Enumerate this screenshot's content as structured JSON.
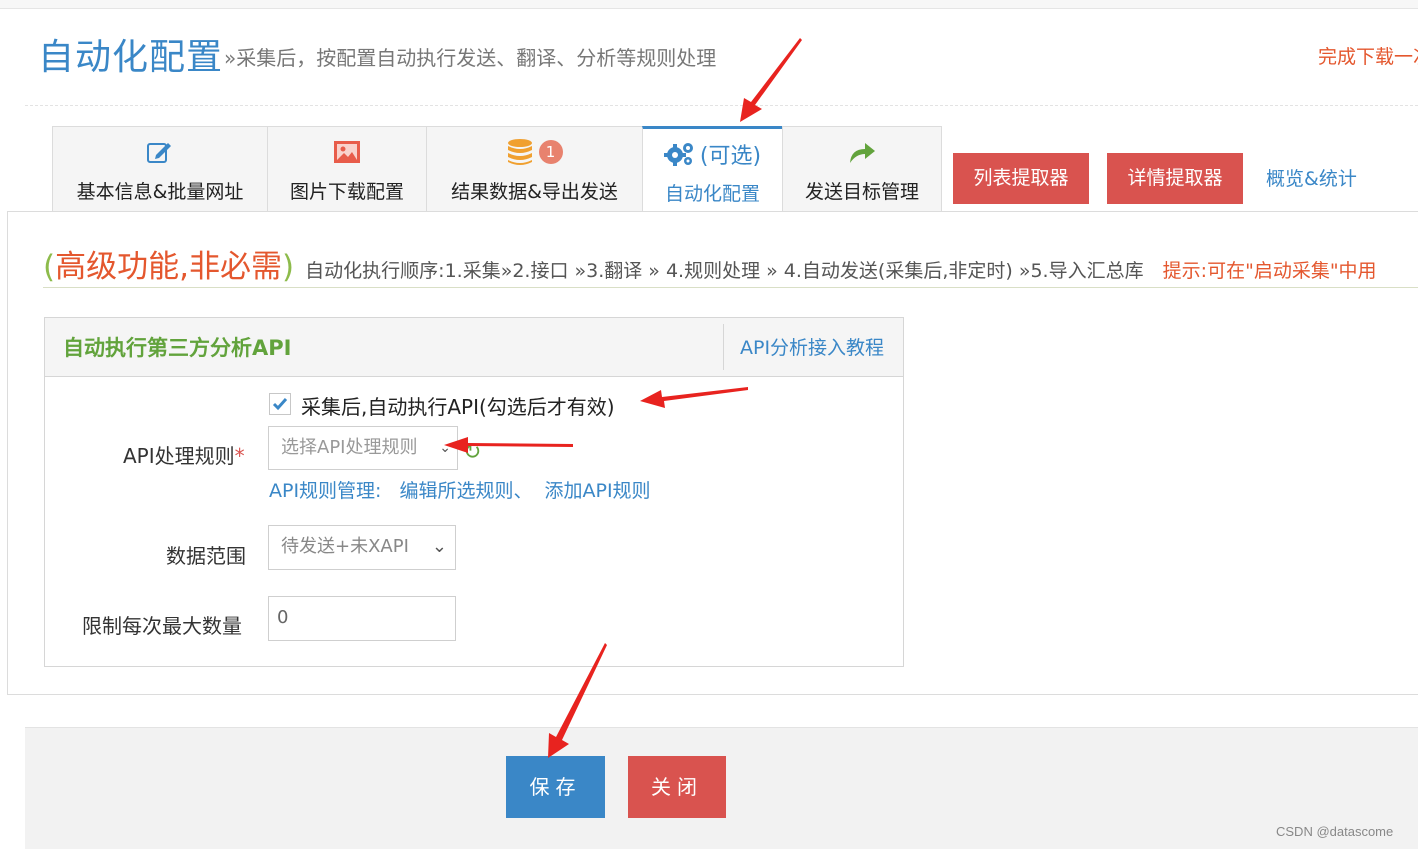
{
  "header": {
    "title": "自动化配置",
    "subtitle": "»采集后，按配置自动执行发送、翻译、分析等规则处理",
    "right_link": "完成下载一次"
  },
  "tabs": [
    {
      "label": "基本信息&批量网址",
      "icon": "edit-icon"
    },
    {
      "label": "图片下载配置",
      "icon": "image-icon"
    },
    {
      "label": "结果数据&导出发送",
      "icon": "database-icon",
      "badge": "1"
    },
    {
      "label": "自动化配置",
      "icon": "gears-icon",
      "sub": "(可选)",
      "active": true
    },
    {
      "label": "发送目标管理",
      "icon": "share-arrow-icon"
    }
  ],
  "actions": {
    "list_extractor": "列表提取器",
    "detail_extractor": "详情提取器",
    "overview": "概览&统计"
  },
  "advanced": {
    "title_open": "(",
    "title": "高级功能,非必需",
    "title_close": ")",
    "order": "自动化执行顺序:1.采集»2.接口 »3.翻译 » 4.规则处理 » 4.自动发送(采集后,非定时) »5.导入汇总库",
    "tip": "提示:可在\"启动采集\"中用"
  },
  "panel": {
    "title": "自动执行第三方分析API",
    "tutorial_link": "API分析接入教程",
    "checkbox_label": "采集后,自动执行API(勾选后才有效)",
    "checkbox_checked": true,
    "api_rule_label": "API处理规则",
    "required_mark": "*",
    "api_rule_placeholder": "选择API处理规则",
    "rule_manage_label": "API规则管理:",
    "edit_rule_link": "编辑所选规则、",
    "add_rule_link": "添加API规则",
    "data_range_label": "数据范围",
    "data_range_value": "待发送+未XAPI",
    "max_count_label": "限制每次最大数量",
    "max_count_value": "0"
  },
  "footer": {
    "save": "保存",
    "close": "关闭"
  },
  "watermark": "CSDN @datascome",
  "colors": {
    "primary": "#3a87c7",
    "danger": "#d9534f",
    "success": "#62a33c",
    "warning_text": "#e4572e"
  }
}
